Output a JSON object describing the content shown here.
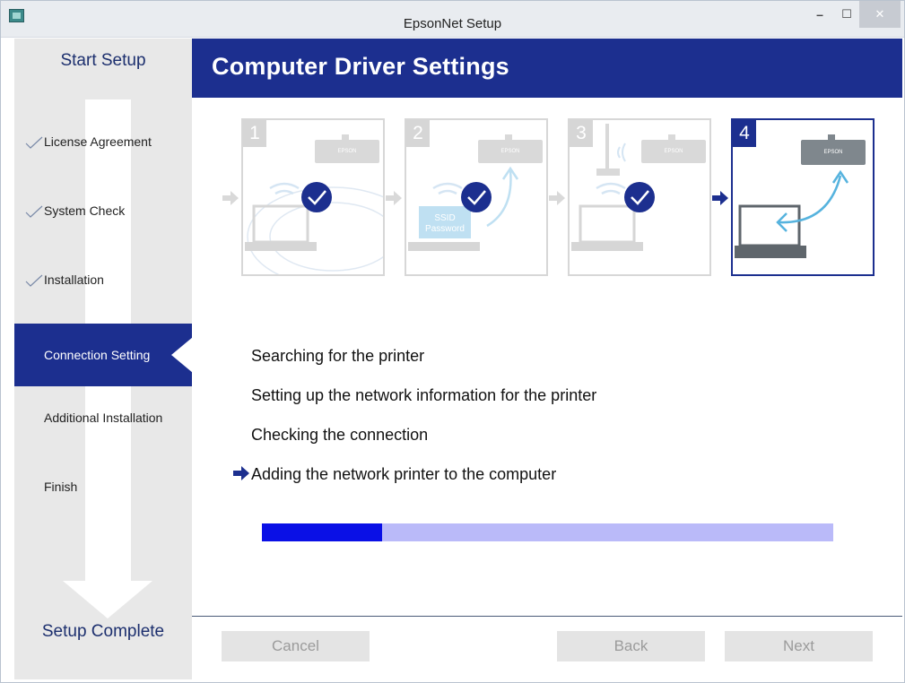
{
  "window": {
    "title": "EpsonNet Setup"
  },
  "sidebar": {
    "top_label": "Start Setup",
    "bottom_label": "Setup Complete",
    "steps": [
      {
        "label": "License Agreement",
        "done": true
      },
      {
        "label": "System Check",
        "done": true
      },
      {
        "label": "Installation",
        "done": true
      },
      {
        "label": "Connection Setting",
        "active": true
      },
      {
        "label": "Additional Installation"
      },
      {
        "label": "Finish"
      }
    ]
  },
  "header": {
    "title": "Computer Driver Settings"
  },
  "illustration": {
    "panels": [
      {
        "number": "1",
        "brand": "EPSON"
      },
      {
        "number": "2",
        "brand": "EPSON",
        "card_line1": "SSID",
        "card_line2": "Password"
      },
      {
        "number": "3",
        "brand": "EPSON"
      },
      {
        "number": "4",
        "brand": "EPSON"
      }
    ]
  },
  "status": {
    "items": [
      "Searching for the printer",
      "Setting up the network information for the printer",
      "Checking the connection",
      "Adding the network printer to the computer"
    ],
    "current_index": 3
  },
  "progress": {
    "fraction": 0.21
  },
  "footer": {
    "cancel_label": "Cancel",
    "back_label": "Back",
    "next_label": "Next"
  },
  "colors": {
    "accent": "#1c2f8f",
    "progress_fill": "#0a10e6",
    "progress_track": "#babaf9"
  }
}
